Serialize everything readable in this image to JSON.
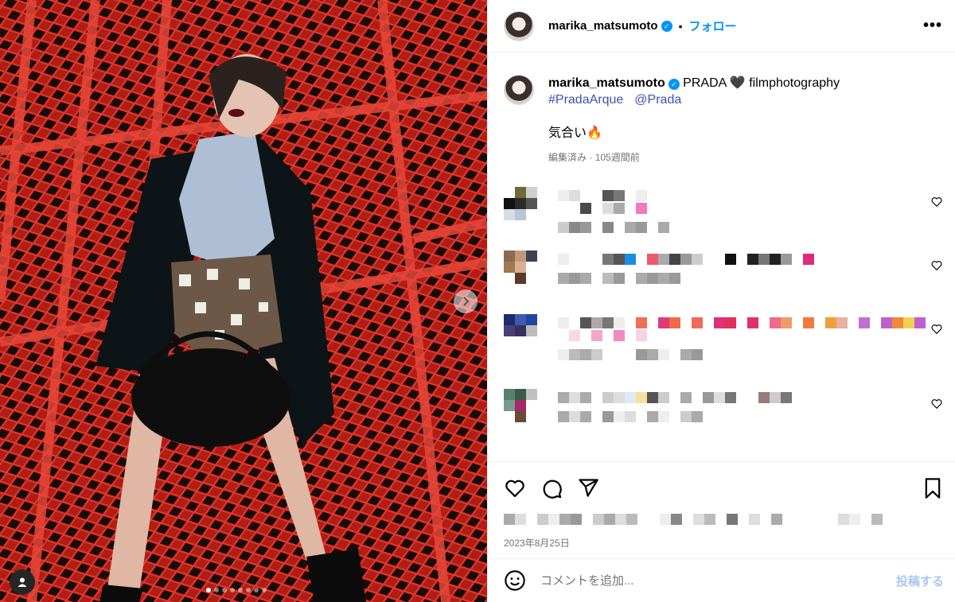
{
  "post": {
    "username": "marika_matsumoto",
    "follow_label": "フォロー",
    "bullet": "•",
    "more_label": "•••"
  },
  "caption": {
    "username": "marika_matsumoto",
    "text": "PRADA 🖤 filmphotography",
    "tags": [
      "#PradaArque",
      "@Prada"
    ],
    "line2": "気合い🔥",
    "edited": "編集済み",
    "time": "105週間前"
  },
  "footer": {
    "date": "2023年8月25日",
    "comment_placeholder": "コメントを追加...",
    "post_label": "投稿する"
  },
  "carousel": {
    "slide_count": 8,
    "active_slide": 1
  },
  "colors": {
    "accent": "#0095f6",
    "tag": "#3f51b5",
    "background_red": "#c6241c"
  },
  "icons": {
    "like": "heart-icon",
    "comment": "comment-icon",
    "share": "share-icon",
    "save": "bookmark-icon",
    "emoji": "emoji-icon",
    "next": "chevron-right-icon",
    "tagged": "person-icon"
  }
}
